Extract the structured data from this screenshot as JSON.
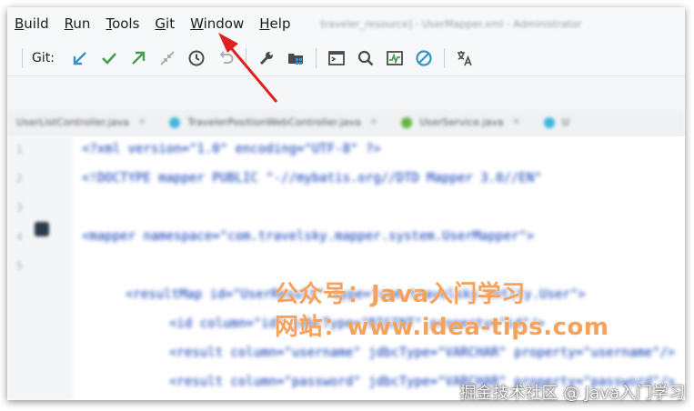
{
  "menu": {
    "items": [
      {
        "mnemonic": "B",
        "rest": "uild"
      },
      {
        "mnemonic": "R",
        "rest": "un"
      },
      {
        "mnemonic": "T",
        "rest": "ools"
      },
      {
        "mnemonic": "G",
        "rest": "it"
      },
      {
        "mnemonic": "W",
        "rest": "indow"
      },
      {
        "mnemonic": "H",
        "rest": "elp"
      }
    ],
    "title_blurred": "traveler_resource] - UserMapper.xml - Administrator"
  },
  "toolbar": {
    "git_label": "Git:",
    "icons": [
      "update-project-icon",
      "commit-check-icon",
      "push-icon",
      "merge-icon",
      "history-clock-icon",
      "rollback-icon",
      "wrench-icon",
      "project-structure-icon",
      "terminal-icon",
      "search-icon",
      "monitor-chart-icon",
      "disable-icon",
      "translate-icon"
    ],
    "colors": {
      "update": "#3592c4",
      "commit": "#499c54",
      "push": "#499c54",
      "disabled": "#b0b0b0",
      "blue": "#3592c4",
      "dark": "#4a4a4a"
    }
  },
  "tabs": [
    {
      "label": "UserListController.java",
      "color": "#40b6e0"
    },
    {
      "label": "TravelerPositionWebController.java",
      "color": "#40b6e0"
    },
    {
      "label": "UserService.java",
      "color": "#62b543"
    },
    {
      "label": "U",
      "color": "#40b6e0"
    }
  ],
  "code": {
    "line1_pi": "<?xml version=\"1.0\" encoding=\"UTF-8\" ?>",
    "line2": "<!DOCTYPE mapper PUBLIC \"-//mybatis.org//DTD Mapper 3.0//EN\"",
    "line4": "<mapper namespace=\"com.travelsky.mapper.system.UserMapper\">",
    "line6": "<resultMap id=\"UserResult\" type=\"com.travelsky.entity.User\">",
    "line7": "<id column=\"id\" jdbcType=\"BIGINT\" property=\"id\"/>",
    "line8": "<result column=\"username\" jdbcType=\"VARCHAR\" property=\"username\"/>",
    "line9": "<result column=\"password\" jdbcType=\"VARCHAR\" property=\"password\"/>"
  },
  "watermark": {
    "line1": "公众号：Java入门学习",
    "line2": "网站：www.idea-tips.com",
    "bottom": "掘金技术社区 @ Java入门学习"
  },
  "annotation": {
    "arrow_color": "#e02020"
  }
}
